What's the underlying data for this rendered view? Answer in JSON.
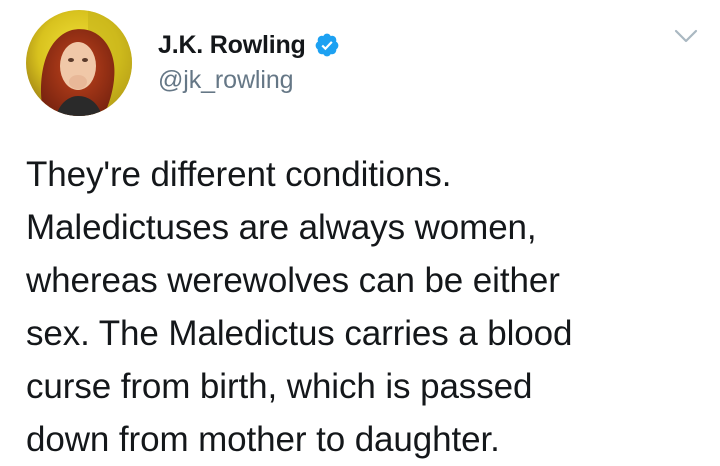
{
  "author": {
    "display_name": "J.K. Rowling",
    "handle": "@jk_rowling",
    "verified": true,
    "avatar_icon": "profile-photo"
  },
  "menu": {
    "icon": "chevron-down-icon"
  },
  "tweet": {
    "lines": [
      "They're different conditions.",
      "Maledictuses are always women,",
      "whereas werewolves can be either",
      "sex. The Maledictus carries a blood",
      "curse from birth, which is passed",
      "down from mother to daughter."
    ]
  },
  "colors": {
    "text": "#14171a",
    "secondary": "#657786",
    "verified": "#1da1f2",
    "caret": "#aab8c2"
  }
}
